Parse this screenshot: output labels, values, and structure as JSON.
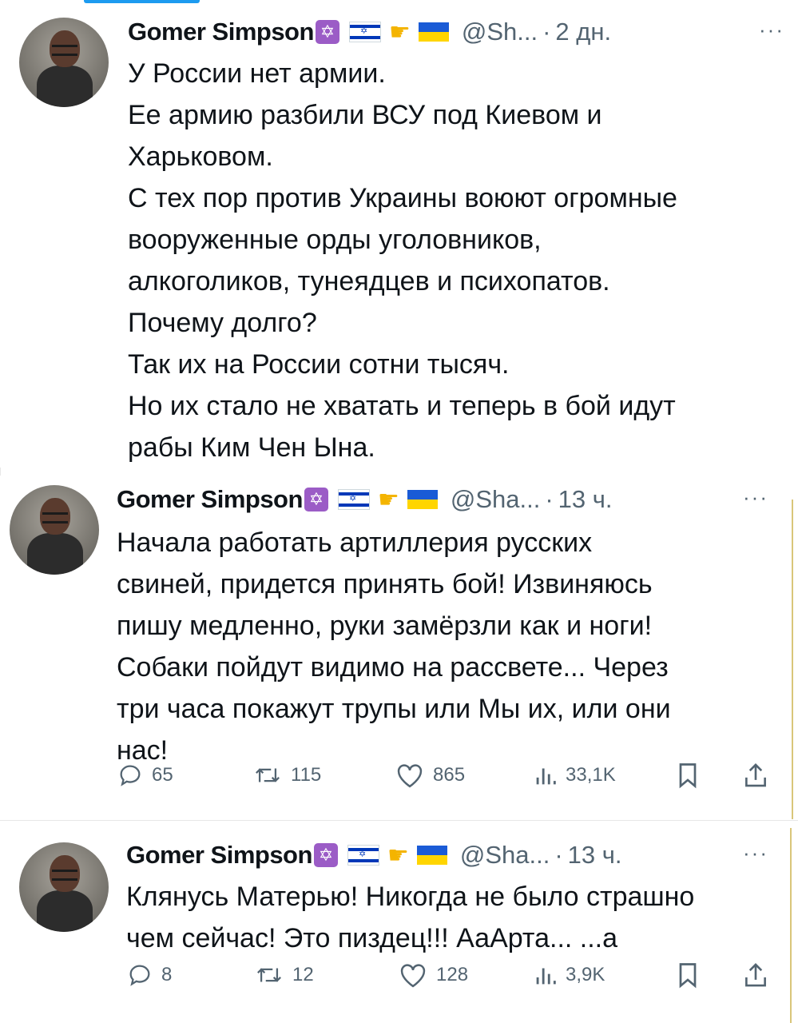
{
  "tweets": [
    {
      "name": "Gomer Simpson",
      "badge": "✡",
      "handle": "@Sh...",
      "time": "2 дн.",
      "more": "···",
      "lines": [
        "У России нет армии.",
        "Ее армию разбили ВСУ под Киевом и",
        "Харьковом.",
        "С тех пор против Украины воюют огромные",
        "вооруженные орды уголовников,",
        "алкоголиков, тунеядцев и психопатов.",
        "Почему долго?",
        "Так их на России сотни тысяч.",
        "Но их стало не хватать и теперь в бой идут",
        "рабы Ким Чен Ына."
      ]
    },
    {
      "name": "Gomer Simpson",
      "badge": "✡",
      "handle": "@Sha...",
      "time": "13 ч.",
      "more": "···",
      "lines": [
        "Начала работать артиллерия русских",
        "свиней, придется принять бой! Извиняюсь",
        "пишу медленно, руки замёрзли как и ноги!",
        "Собаки пойдут видимо на рассвете... Через",
        "три часа покажут трупы или Мы их, или они",
        "нас!"
      ],
      "stats": {
        "replies": "65",
        "retweets": "115",
        "likes": "865",
        "views": "33,1K"
      }
    },
    {
      "name": "Gomer Simpson",
      "badge": "✡",
      "handle": "@Sha...",
      "time": "13 ч.",
      "more": "···",
      "lines": [
        "Клянусь Матерью! Никогда не было страшно",
        "чем сейчас! Это пиздец!!! АаАрта... ...а"
      ],
      "stats": {
        "replies": "8",
        "retweets": "12",
        "likes": "128",
        "views": "3,9K"
      }
    }
  ],
  "colors": {
    "accent": "#1d9bf0",
    "text": "#0f1419",
    "muted": "#536471",
    "badge": "#9b5cc6"
  }
}
